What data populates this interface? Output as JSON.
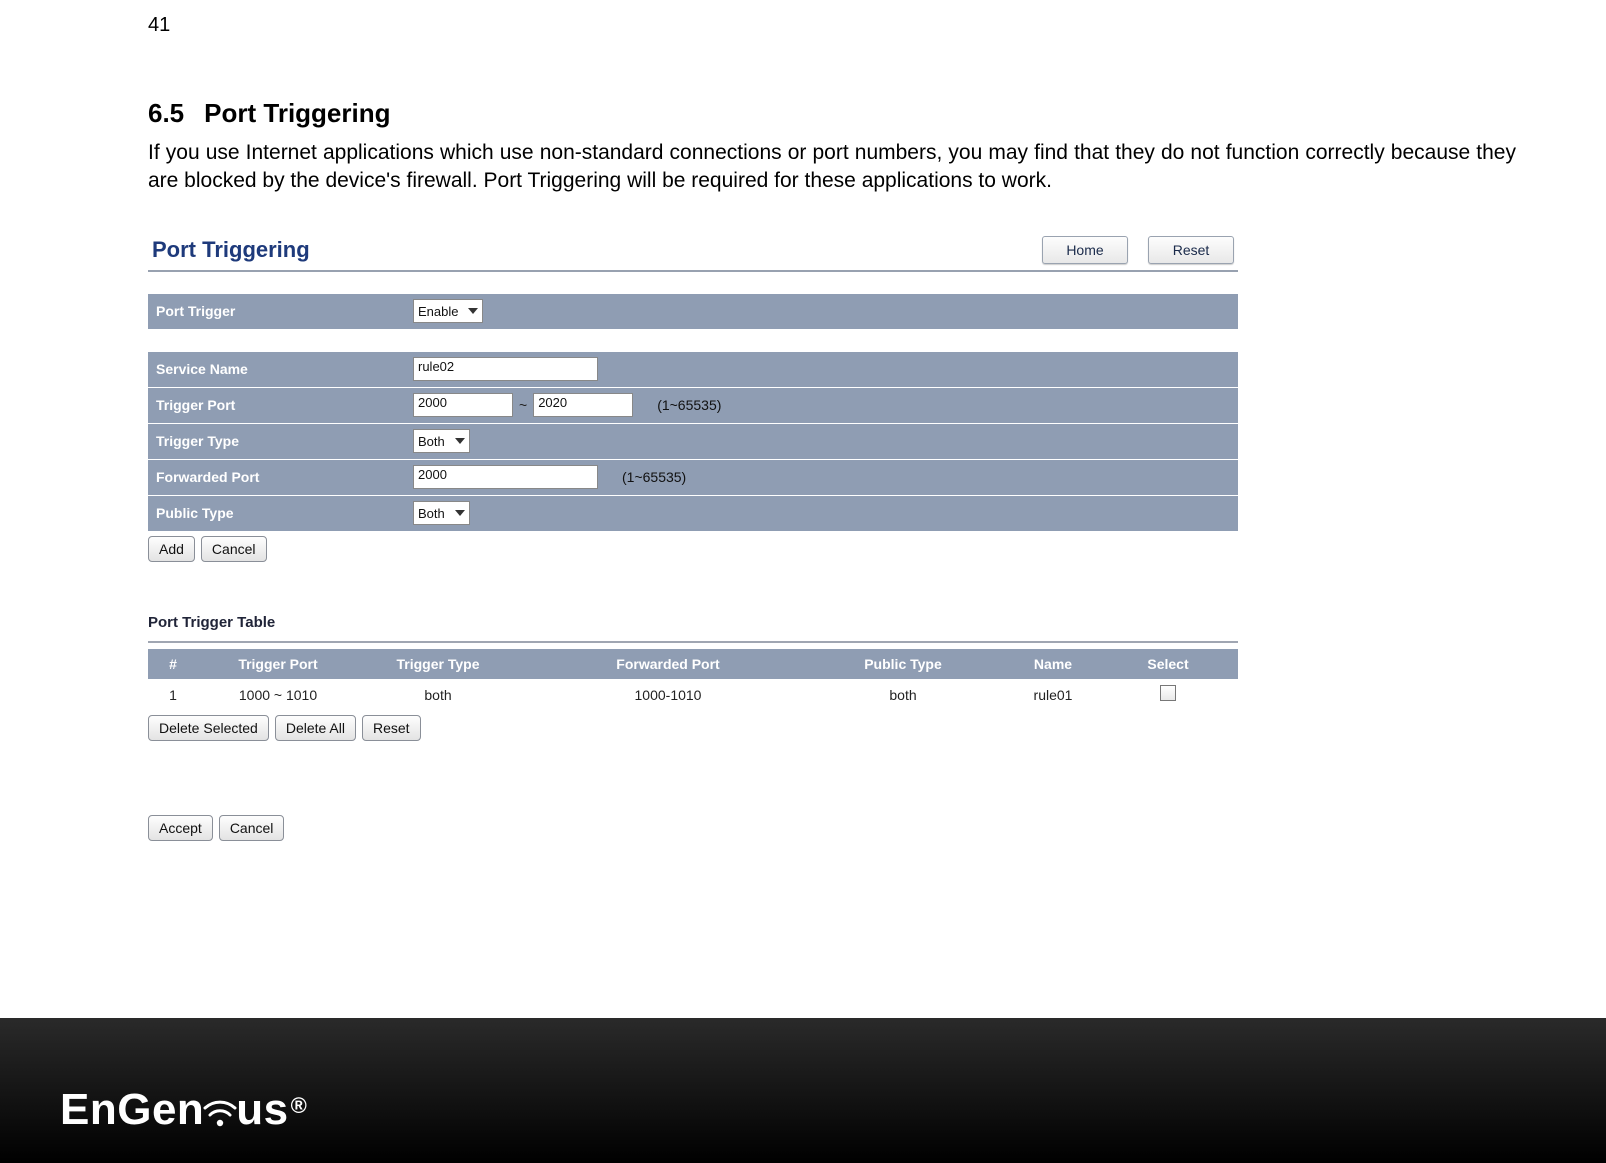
{
  "page_number": "41",
  "section": {
    "number": "6.5",
    "title": "Port Triggering"
  },
  "body_text": "If you use Internet applications which use non-standard connections or port numbers, you may find that they do not function correctly because they are blocked by the device's firewall. Port Triggering will be required for these applications to work.",
  "panel": {
    "title": "Port Triggering",
    "buttons": {
      "home": "Home",
      "reset": "Reset"
    },
    "rows": {
      "port_trigger": {
        "label": "Port Trigger",
        "value": "Enable"
      },
      "service_name": {
        "label": "Service Name",
        "value": "rule02"
      },
      "trigger_port": {
        "label": "Trigger Port",
        "from": "2000",
        "sep": "~",
        "to": "2020",
        "hint": "(1~65535)"
      },
      "trigger_type": {
        "label": "Trigger Type",
        "value": "Both"
      },
      "forwarded_port": {
        "label": "Forwarded Port",
        "value": "2000",
        "hint": "(1~65535)"
      },
      "public_type": {
        "label": "Public Type",
        "value": "Both"
      }
    },
    "form_buttons": {
      "add": "Add",
      "cancel": "Cancel"
    }
  },
  "table": {
    "title": "Port Trigger Table",
    "headers": {
      "idx": "#",
      "trigger_port": "Trigger Port",
      "trigger_type": "Trigger Type",
      "forwarded_port": "Forwarded Port",
      "public_type": "Public Type",
      "name": "Name",
      "select": "Select"
    },
    "rows": [
      {
        "idx": "1",
        "trigger_port": "1000 ~ 1010",
        "trigger_type": "both",
        "forwarded_port": "1000-1010",
        "public_type": "both",
        "name": "rule01"
      }
    ],
    "buttons": {
      "delete_selected": "Delete Selected",
      "delete_all": "Delete All",
      "reset": "Reset"
    }
  },
  "bottom_buttons": {
    "accept": "Accept",
    "cancel": "Cancel"
  },
  "logo": {
    "part1": "EnGen",
    "part2": "us"
  }
}
